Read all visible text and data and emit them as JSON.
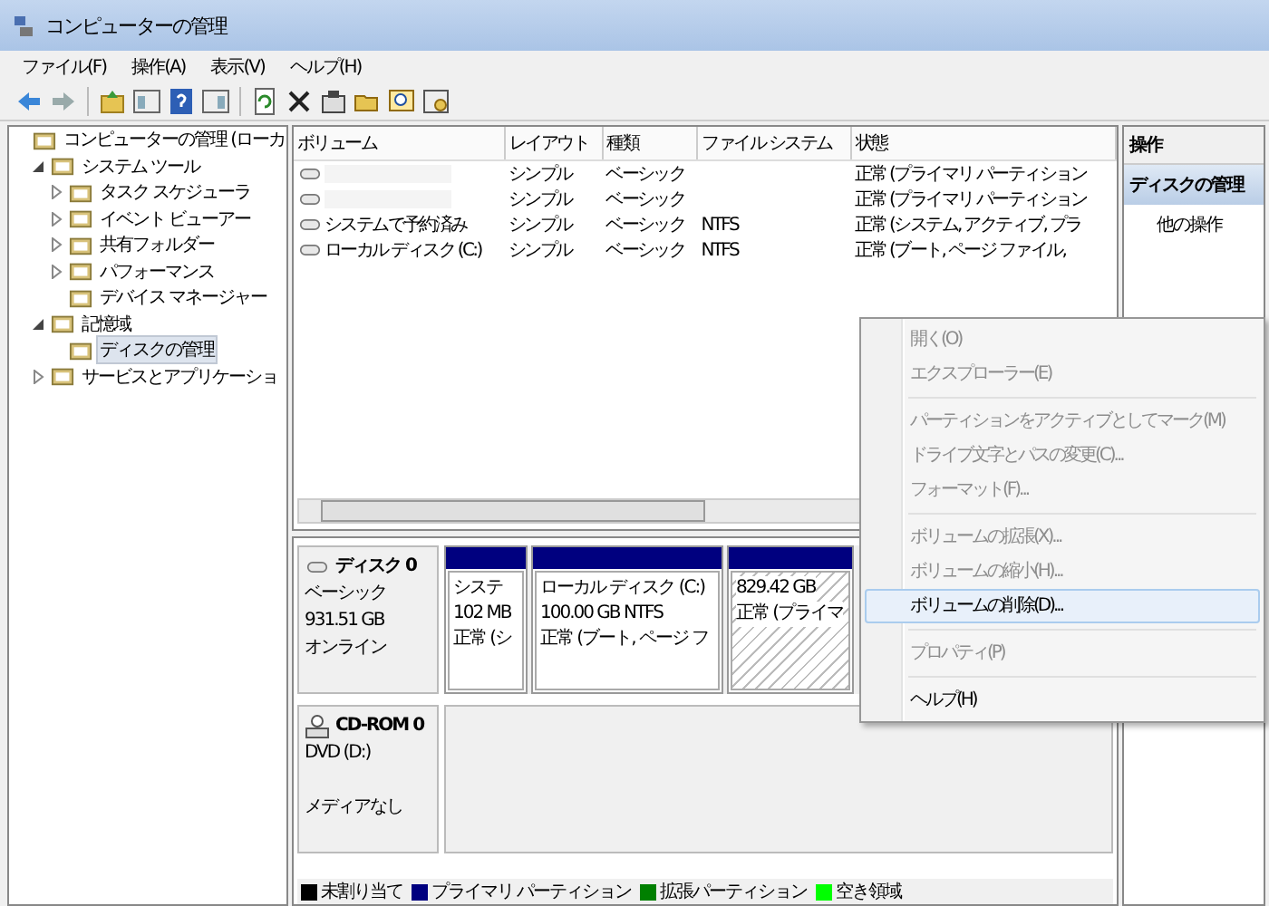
{
  "window": {
    "title": "コンピューターの管理"
  },
  "menubar": [
    "ファイル(F)",
    "操作(A)",
    "表示(V)",
    "ヘルプ(H)"
  ],
  "tree": [
    {
      "label": "コンピューターの管理 (ローカ",
      "selected": false,
      "children": [
        {
          "label": "システム ツール",
          "selected": false,
          "expanded": true,
          "children": [
            {
              "label": "タスク スケジューラ",
              "selected": false,
              "expanded": false
            },
            {
              "label": "イベント ビューアー",
              "selected": false,
              "expanded": false
            },
            {
              "label": "共有フォルダー",
              "selected": false,
              "expanded": false
            },
            {
              "label": "パフォーマンス",
              "selected": false,
              "expanded": false
            },
            {
              "label": "デバイス マネージャー",
              "selected": false
            }
          ]
        },
        {
          "label": "記憶域",
          "selected": false,
          "expanded": true,
          "children": [
            {
              "label": "ディスクの管理",
              "selected": true
            }
          ]
        },
        {
          "label": "サービスとアプリケーショ",
          "selected": false,
          "expanded": false
        }
      ]
    }
  ],
  "volumes": {
    "columns": [
      "ボリューム",
      "レイアウト",
      "種類",
      "ファイル システム",
      "状態"
    ],
    "rows": [
      {
        "layout": "シンプル",
        "type": "ベーシック",
        "status": "正常 (プライマリ パーティション"
      },
      {
        "layout": "シンプル",
        "type": "ベーシック",
        "status": "正常 (プライマリ パーティション"
      },
      {
        "volume": "システムで予約済み",
        "layout": "シンプル",
        "type": "ベーシック",
        "fs": "NTFS",
        "status": "正常 (システム, アクティブ, プラ"
      },
      {
        "volume": "ローカル ディスク (C:)",
        "layout": "シンプル",
        "type": "ベーシック",
        "fs": "NTFS",
        "status": "正常 (ブート, ページ ファイル,"
      }
    ]
  },
  "disks": [
    {
      "kind": "disk",
      "name": "ディスク 0",
      "lines": [
        "ベーシック",
        "931.51 GB"
      ],
      "status": "オンライン",
      "partitions": [
        {
          "lines": [
            "システ",
            "102 MB",
            "正常 (シ"
          ],
          "selected": false
        },
        {
          "lines": [
            "ローカル ディスク (C:)",
            "100.00 GB NTFS",
            "正常 (ブート, ページ フ"
          ],
          "selected": false
        },
        {
          "lines": [
            "829.42 GB",
            "正常 (プライマ"
          ],
          "selected": true
        }
      ]
    },
    {
      "kind": "cdrom",
      "name": "CD-ROM 0",
      "lines": [
        "DVD (D:)"
      ],
      "status": "メディアなし"
    }
  ],
  "legend": [
    {
      "label": "未割り当て",
      "color": "#000000"
    },
    {
      "label": "プライマリ パーティション",
      "color": "#00007f"
    },
    {
      "label": "拡張パーティション",
      "color": "#008000"
    },
    {
      "label": "空き領域",
      "color": "#00ff00"
    }
  ],
  "actions": {
    "header": "操作",
    "items": [
      {
        "label": "ディスクの管理",
        "selected": true
      },
      {
        "label": "他の操作",
        "selected": false
      }
    ]
  },
  "context_menu": [
    {
      "kind": "item",
      "label": "開く(O)",
      "disabled": true,
      "selected": false
    },
    {
      "kind": "item",
      "label": "エクスプローラー(E)",
      "disabled": true,
      "selected": false
    },
    {
      "kind": "separator"
    },
    {
      "kind": "item",
      "label": "パーティションをアクティブとしてマーク(M)",
      "disabled": true,
      "selected": false
    },
    {
      "kind": "item",
      "label": "ドライブ文字とパスの変更(C)...",
      "disabled": true,
      "selected": false
    },
    {
      "kind": "item",
      "label": "フォーマット(F)...",
      "disabled": true,
      "selected": false
    },
    {
      "kind": "separator"
    },
    {
      "kind": "item",
      "label": "ボリュームの拡張(X)...",
      "disabled": true,
      "selected": false
    },
    {
      "kind": "item",
      "label": "ボリュームの縮小(H)...",
      "disabled": true,
      "selected": false
    },
    {
      "kind": "item",
      "label": "ボリュームの削除(D)...",
      "disabled": false,
      "selected": true
    },
    {
      "kind": "separator"
    },
    {
      "kind": "item",
      "label": "プロパティ(P)",
      "disabled": true,
      "selected": false
    },
    {
      "kind": "separator"
    },
    {
      "kind": "item",
      "label": "ヘルプ(H)",
      "disabled": false,
      "selected": false
    }
  ]
}
